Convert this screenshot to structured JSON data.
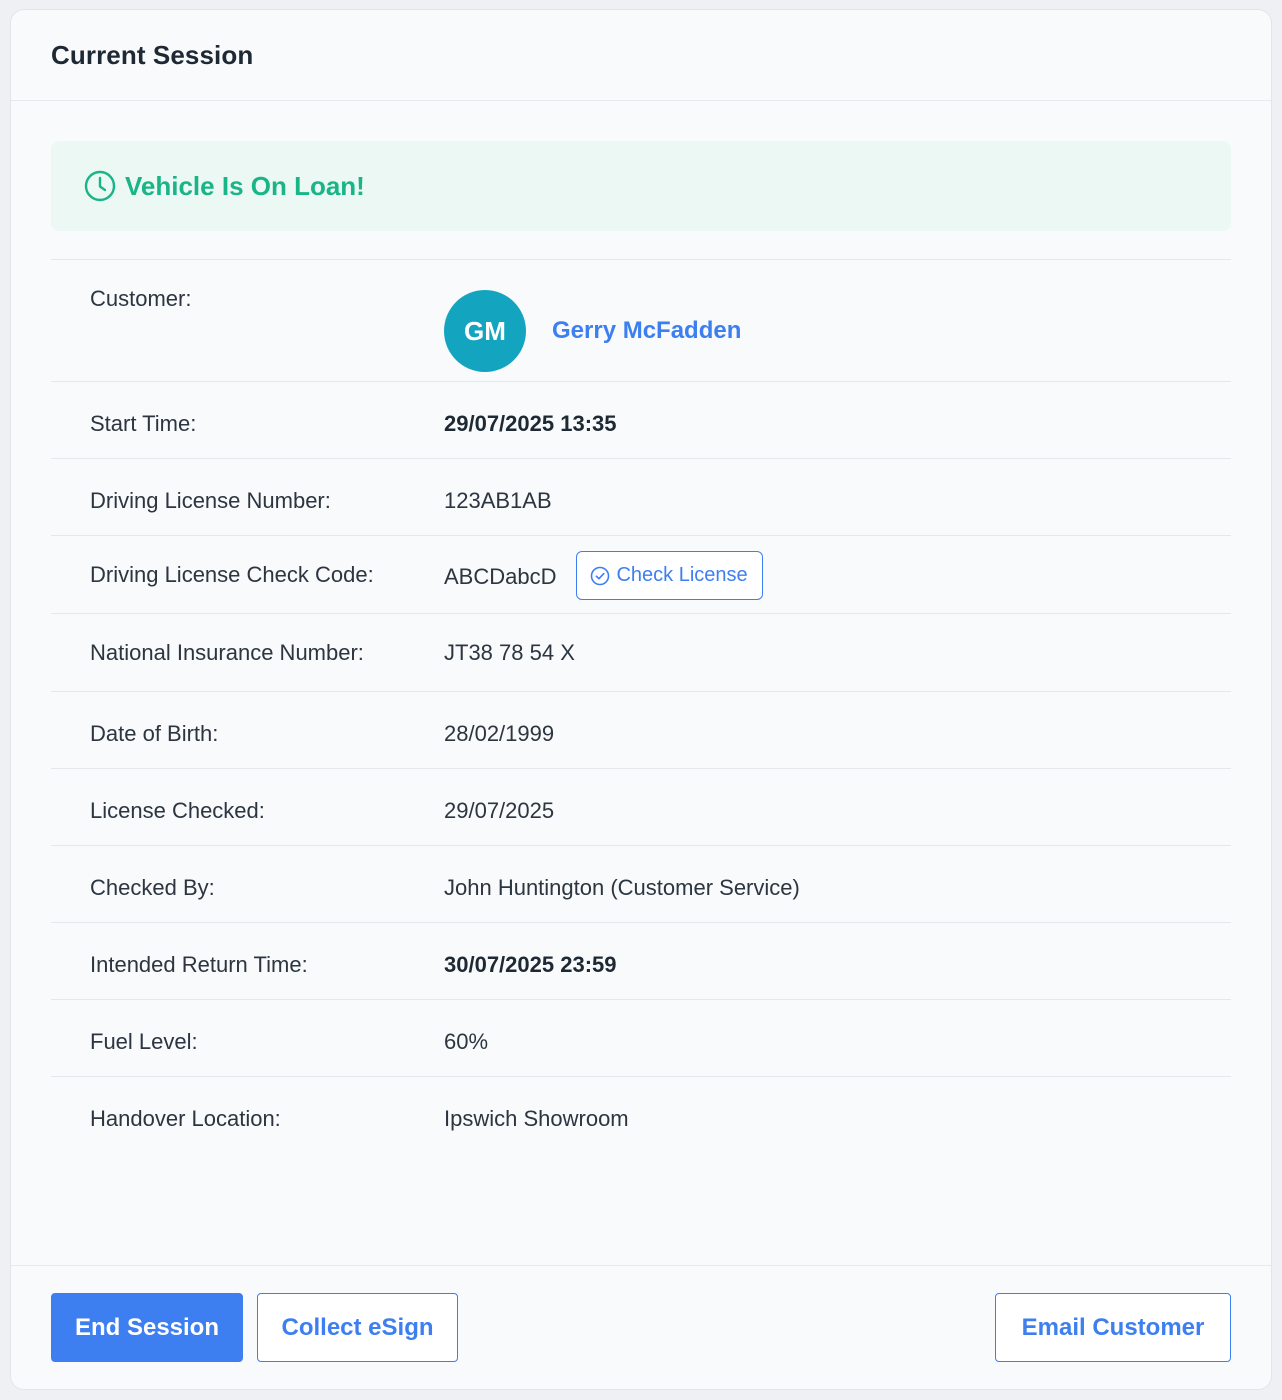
{
  "card": {
    "title": "Current Session"
  },
  "alert": {
    "icon": "clock-icon",
    "text": "Vehicle Is On Loan!",
    "color": "#19b587"
  },
  "customer": {
    "label": "Customer:",
    "initials": "GM",
    "name": "Gerry McFadden",
    "avatar_color": "#13a5bf"
  },
  "details": {
    "start_time": {
      "label": "Start Time:",
      "value": "29/07/2025 13:35"
    },
    "license_number": {
      "label": "Driving License Number:",
      "value": "123AB1AB"
    },
    "license_check_code": {
      "label": "Driving License Check Code:",
      "value": "ABCDabcD",
      "button_label": "Check License"
    },
    "ni_number": {
      "label": "National Insurance Number:",
      "value": "JT38 78 54 X"
    },
    "dob": {
      "label": "Date of Birth:",
      "value": "28/02/1999"
    },
    "license_checked": {
      "label": "License Checked:",
      "value": "29/07/2025"
    },
    "checked_by": {
      "label": "Checked By:",
      "value": "John Huntington (Customer Service)"
    },
    "return_time": {
      "label": "Intended Return Time:",
      "value": "30/07/2025 23:59"
    },
    "fuel_level": {
      "label": "Fuel Level:",
      "value": "60%"
    },
    "handover_location": {
      "label": "Handover Location:",
      "value": "Ipswich Showroom"
    }
  },
  "footer": {
    "end_session_label": "End Session",
    "collect_esign_label": "Collect eSign",
    "email_customer_label": "Email Customer"
  },
  "colors": {
    "accent": "#3d7ff0",
    "alert_bg": "#ecf8f3"
  }
}
